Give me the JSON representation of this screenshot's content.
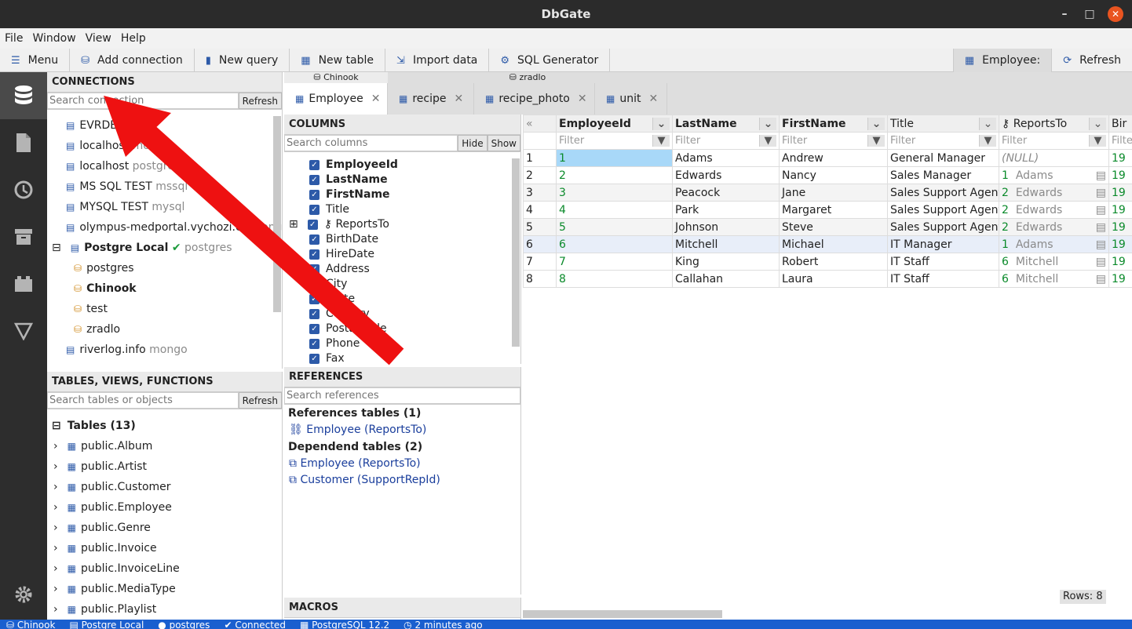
{
  "window": {
    "title": "DbGate"
  },
  "menu": [
    "File",
    "Window",
    "View",
    "Help"
  ],
  "toolbar": {
    "menu": "Menu",
    "add_connection": "Add connection",
    "new_query": "New query",
    "new_table": "New table",
    "import_data": "Import data",
    "sql_generator": "SQL Generator",
    "employee": "Employee:",
    "refresh": "Refresh"
  },
  "connections": {
    "header": "CONNECTIONS",
    "search_placeholder": "Search connection",
    "refresh": "Refresh",
    "items": [
      {
        "name": "EVRDB",
        "engine": ""
      },
      {
        "name": "localhost",
        "engine": "mo"
      },
      {
        "name": "localhost",
        "engine": "postgre"
      },
      {
        "name": "MS SQL TEST",
        "engine": "mssql"
      },
      {
        "name": "MYSQL TEST",
        "engine": "mysql"
      },
      {
        "name": "olympus-medportal.vychozi.cz",
        "engine": "mongo"
      },
      {
        "name": "Postgre Local",
        "engine": "postgres"
      },
      {
        "name": "riverlog.info",
        "engine": "mongo"
      }
    ],
    "databases": [
      "postgres",
      "Chinook",
      "test",
      "zradlo"
    ]
  },
  "objects": {
    "header": "TABLES, VIEWS, FUNCTIONS",
    "search_placeholder": "Search tables or objects",
    "refresh": "Refresh",
    "group": "Tables (13)",
    "tables": [
      "public.Album",
      "public.Artist",
      "public.Customer",
      "public.Employee",
      "public.Genre",
      "public.Invoice",
      "public.InvoiceLine",
      "public.MediaType",
      "public.Playlist"
    ]
  },
  "tab_groups": {
    "chinook": "Chinook",
    "zradlo": "zradlo"
  },
  "tabs": [
    "Employee",
    "recipe",
    "recipe_photo",
    "unit"
  ],
  "columns_panel": {
    "header": "COLUMNS",
    "search_placeholder": "Search columns",
    "hide": "Hide",
    "show": "Show",
    "items": [
      "EmployeeId",
      "LastName",
      "FirstName",
      "Title",
      "ReportsTo",
      "BirthDate",
      "HireDate",
      "Address",
      "City",
      "State",
      "Country",
      "PostalCode",
      "Phone",
      "Fax"
    ]
  },
  "references": {
    "header": "REFERENCES",
    "search_placeholder": "Search references",
    "ref_title": "References tables (1)",
    "ref_item": "Employee (ReportsTo)",
    "dep_title": "Dependend tables (2)",
    "dep_items": [
      "Employee (ReportsTo)",
      "Customer (SupportRepId)"
    ]
  },
  "macros": {
    "header": "MACROS"
  },
  "grid": {
    "columns": [
      "EmployeeId",
      "LastName",
      "FirstName",
      "Title",
      "ReportsTo",
      "Bir"
    ],
    "filter_placeholder": "Filter",
    "rows": [
      {
        "n": "1",
        "id": "1",
        "last": "Adams",
        "first": "Andrew",
        "title": "General Manager",
        "rid": "",
        "rname": "(NULL)",
        "bir": "19"
      },
      {
        "n": "2",
        "id": "2",
        "last": "Edwards",
        "first": "Nancy",
        "title": "Sales Manager",
        "rid": "1",
        "rname": "Adams",
        "bir": "19"
      },
      {
        "n": "3",
        "id": "3",
        "last": "Peacock",
        "first": "Jane",
        "title": "Sales Support Agent",
        "rid": "2",
        "rname": "Edwards",
        "bir": "19"
      },
      {
        "n": "4",
        "id": "4",
        "last": "Park",
        "first": "Margaret",
        "title": "Sales Support Agent",
        "rid": "2",
        "rname": "Edwards",
        "bir": "19"
      },
      {
        "n": "5",
        "id": "5",
        "last": "Johnson",
        "first": "Steve",
        "title": "Sales Support Agent",
        "rid": "2",
        "rname": "Edwards",
        "bir": "19"
      },
      {
        "n": "6",
        "id": "6",
        "last": "Mitchell",
        "first": "Michael",
        "title": "IT Manager",
        "rid": "1",
        "rname": "Adams",
        "bir": "19"
      },
      {
        "n": "7",
        "id": "7",
        "last": "King",
        "first": "Robert",
        "title": "IT Staff",
        "rid": "6",
        "rname": "Mitchell",
        "bir": "19"
      },
      {
        "n": "8",
        "id": "8",
        "last": "Callahan",
        "first": "Laura",
        "title": "IT Staff",
        "rid": "6",
        "rname": "Mitchell",
        "bir": "19"
      }
    ],
    "rows_count": "Rows: 8"
  },
  "statusbar": {
    "db": "Chinook",
    "connection": "Postgre Local",
    "user": "postgres",
    "status": "Connected",
    "engine": "PostgreSQL 12.2",
    "time": "2 minutes ago"
  }
}
